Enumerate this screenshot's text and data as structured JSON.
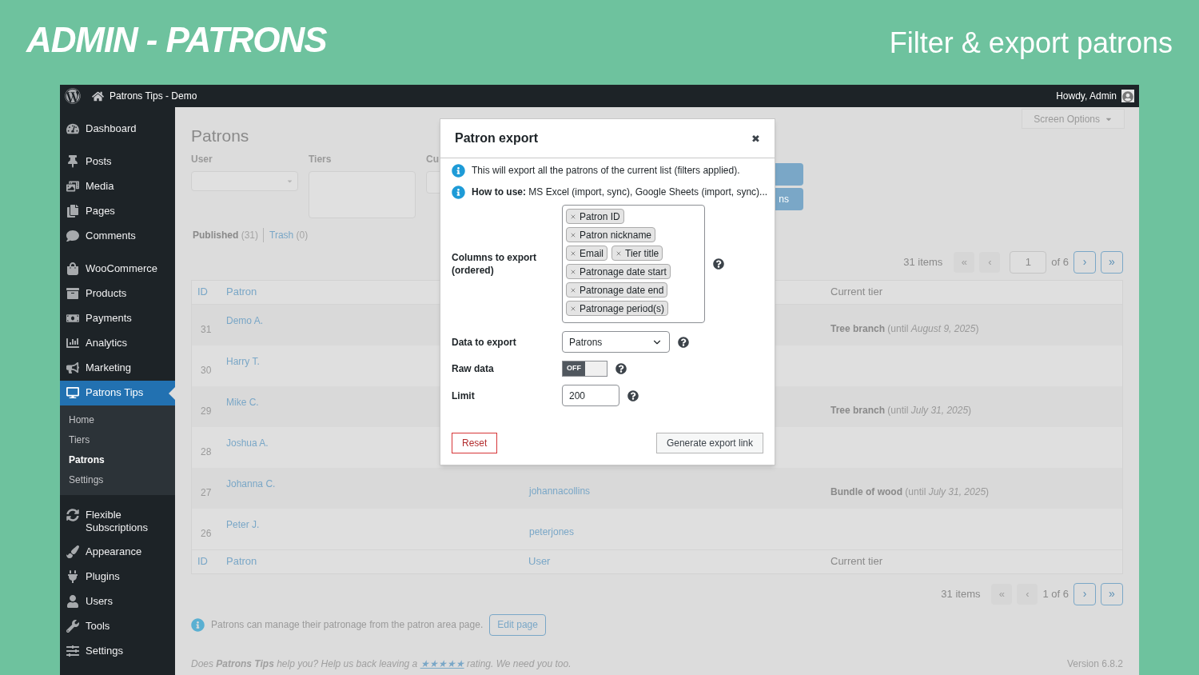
{
  "header": {
    "title": "ADMIN - PATRONS",
    "subtitle": "Filter & export patrons"
  },
  "admin_bar": {
    "site": "Patrons Tips - Demo",
    "greeting": "Howdy, Admin"
  },
  "sidebar": {
    "groups": [
      [
        {
          "label": "Dashboard",
          "selected": false
        }
      ],
      [
        {
          "label": "Posts",
          "selected": false
        },
        {
          "label": "Media",
          "selected": false
        },
        {
          "label": "Pages",
          "selected": false
        },
        {
          "label": "Comments",
          "selected": false
        }
      ],
      [
        {
          "label": "WooCommerce",
          "selected": false
        },
        {
          "label": "Products",
          "selected": false
        },
        {
          "label": "Payments",
          "selected": false
        },
        {
          "label": "Analytics",
          "selected": false
        },
        {
          "label": "Marketing",
          "selected": false
        },
        {
          "label": "Patrons Tips",
          "selected": true,
          "children": [
            {
              "label": "Home",
              "selected": false
            },
            {
              "label": "Tiers",
              "selected": false
            },
            {
              "label": "Patrons",
              "selected": true
            },
            {
              "label": "Settings",
              "selected": false
            }
          ]
        }
      ],
      [
        {
          "label": "Flexible Subscriptions",
          "selected": false
        },
        {
          "label": "Appearance",
          "selected": false
        },
        {
          "label": "Plugins",
          "selected": false
        },
        {
          "label": "Users",
          "selected": false
        },
        {
          "label": "Tools",
          "selected": false
        },
        {
          "label": "Settings",
          "selected": false
        }
      ]
    ]
  },
  "page": {
    "title": "Patrons",
    "screen_options": "Screen Options",
    "filters": [
      {
        "label": "User",
        "kind": "select"
      },
      {
        "label": "Tiers",
        "kind": "multiselect"
      },
      {
        "label": "Cu",
        "kind": "input"
      }
    ],
    "filter_button": "ns",
    "views": [
      {
        "label": "Published",
        "count": "(31)",
        "selected": true
      },
      {
        "label": "Trash",
        "count": "(0)",
        "selected": false
      }
    ]
  },
  "pagination_top": {
    "items": "31 items",
    "page": "1",
    "of": "of 6",
    "buttons": [
      {
        "label": "«",
        "disabled": true
      },
      {
        "label": "‹",
        "disabled": true
      },
      {
        "label": "›",
        "disabled": false
      },
      {
        "label": "»",
        "disabled": false
      }
    ]
  },
  "table": {
    "header": {
      "id": "ID",
      "patron": "Patron",
      "current_tier": "Current tier"
    },
    "rows": [
      {
        "id": "31",
        "patron": "Demo A.",
        "tier": "**Tree branch** (until *August 9, 2025*)"
      },
      {
        "id": "30",
        "patron": "Harry T."
      },
      {
        "id": "29",
        "patron": "Mike C.",
        "tier": "**Tree branch** (until *July 31, 2025*)"
      },
      {
        "id": "28",
        "patron": "Joshua A."
      },
      {
        "id": "27",
        "patron": "Johanna C.",
        "user": "johannacollins",
        "tier": "**Bundle of wood** (until *July 31, 2025*)"
      },
      {
        "id": "26",
        "patron": "Peter J.",
        "user": "peterjones"
      }
    ],
    "footer": {
      "id": "ID",
      "patron": "Patron",
      "user": "User",
      "current_tier": "Current tier"
    }
  },
  "pagination_bottom": {
    "items": "31 items",
    "page": "1 of 6",
    "buttons": [
      {
        "label": "«",
        "disabled": true
      },
      {
        "label": "‹",
        "disabled": true
      },
      {
        "label": "›",
        "disabled": false
      },
      {
        "label": "»",
        "disabled": false
      }
    ]
  },
  "notice": {
    "text": "Patrons can manage their patronage from the patron area page.",
    "button": "Edit page"
  },
  "footer": {
    "text": "Does **Patrons Tips** help you? Help us back leaving a",
    "link": "★★★★★",
    "text_after": "rating. We need you too.",
    "version": "Version 6.8.2"
  },
  "modal": {
    "title": "Patron export",
    "close": "✖",
    "notes": [
      "This will export all the patrons of the current list (filters applied).",
      "**How to use:** MS Excel (import, sync), Google Sheets (import, sync)..."
    ],
    "fields": [
      {
        "kind": "tags",
        "label": "Columns to export (ordered)",
        "tags": [
          "Patron ID",
          "Patron nickname",
          "Email",
          "Tier title",
          "Patronage date start",
          "Patronage date end",
          "Patronage period(s)"
        ]
      },
      {
        "kind": "select",
        "label": "Data to export",
        "value": "Patrons"
      },
      {
        "kind": "toggle",
        "label": "Raw data",
        "on": false,
        "text": "OFF"
      },
      {
        "kind": "input",
        "label": "Limit",
        "value": "200"
      }
    ],
    "reset": "Reset",
    "generate": "Generate export link"
  }
}
